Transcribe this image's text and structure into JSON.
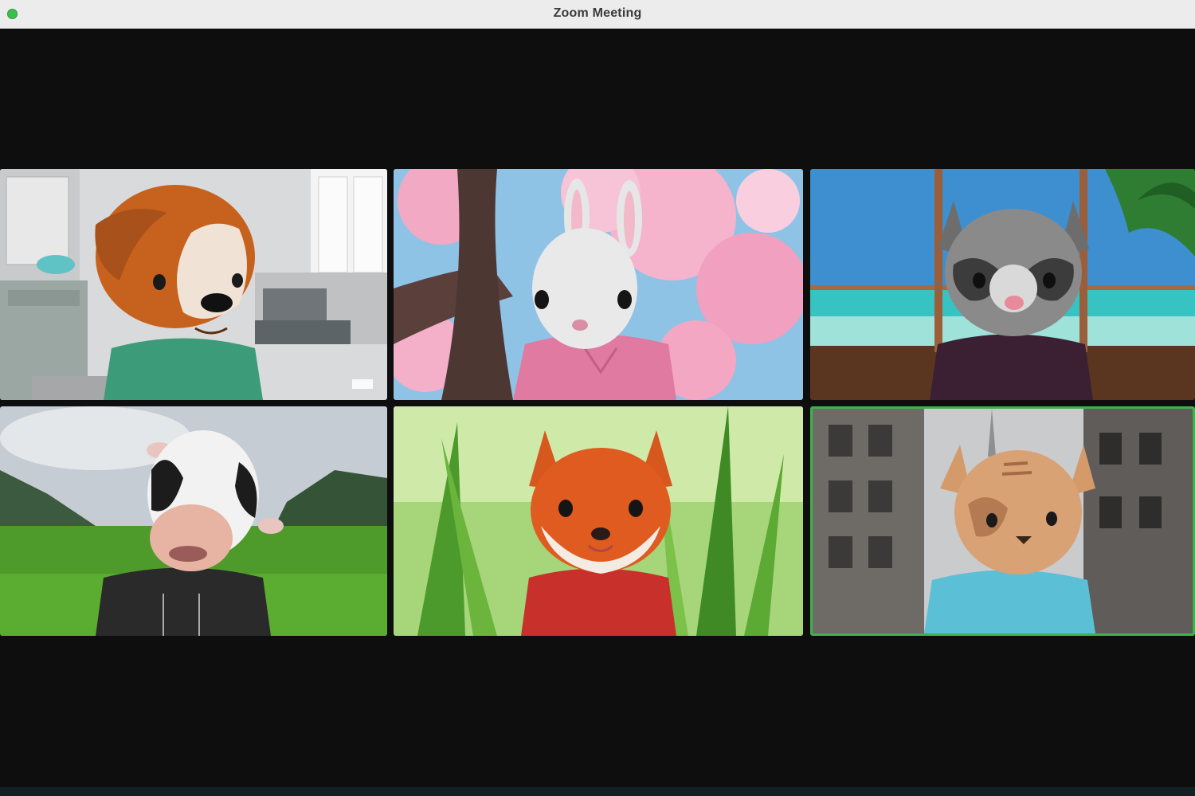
{
  "window": {
    "title": "Zoom Meeting",
    "status_light_color": "#3bbf4c"
  },
  "gallery": {
    "tiles": [
      {
        "avatar": "dog-avatar",
        "scene": "living-room",
        "shirt_color": "#3c9c7a"
      },
      {
        "avatar": "bunny-avatar",
        "scene": "cherry-blossoms",
        "shirt_color": "#e07aa0"
      },
      {
        "avatar": "raccoon-avatar",
        "scene": "beach-window",
        "shirt_color": "#3b1f33"
      },
      {
        "avatar": "cow-avatar",
        "scene": "green-valley",
        "shirt_color": "#2a2a2a"
      },
      {
        "avatar": "fox-avatar",
        "scene": "grass-field",
        "shirt_color": "#c8302c"
      },
      {
        "avatar": "cat-avatar",
        "scene": "city-street",
        "shirt_color": "#5bbfd6",
        "active_speaker": true
      }
    ],
    "active_speaker_color": "#3fb24c"
  }
}
